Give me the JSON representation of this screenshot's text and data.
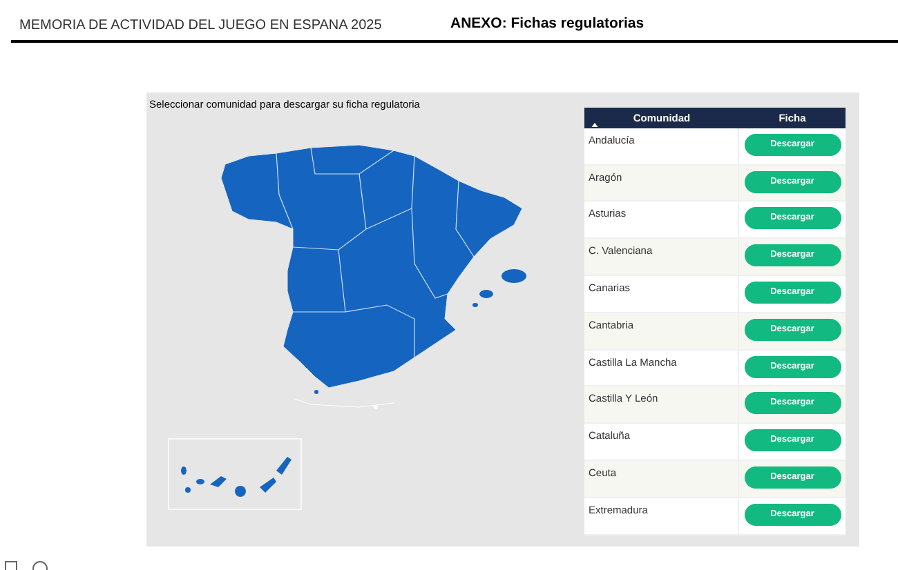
{
  "header": {
    "report_title": "MEMORIA DE ACTIVIDAD DEL JUEGO EN ESPANA 2025",
    "section_title": "ANEXO: Fichas regulatorias"
  },
  "map_panel": {
    "title": "Seleccionar comunidad para descargar su ficha regulatoria"
  },
  "table": {
    "columns": [
      "Comunidad",
      "Ficha"
    ],
    "rows": [
      {
        "comunidad": "Andalucía",
        "ficha": "Descargar"
      },
      {
        "comunidad": "Aragón",
        "ficha": "Descargar"
      },
      {
        "comunidad": "Asturias",
        "ficha": "Descargar"
      },
      {
        "comunidad": "C. Valenciana",
        "ficha": "Descargar"
      },
      {
        "comunidad": "Canarias",
        "ficha": "Descargar"
      },
      {
        "comunidad": "Cantabria",
        "ficha": "Descargar"
      },
      {
        "comunidad": "Castilla La Mancha",
        "ficha": "Descargar"
      },
      {
        "comunidad": "Castilla Y León",
        "ficha": "Descargar"
      },
      {
        "comunidad": "Cataluña",
        "ficha": "Descargar"
      },
      {
        "comunidad": "Ceuta",
        "ficha": "Descargar"
      },
      {
        "comunidad": "Extremadura",
        "ficha": "Descargar"
      }
    ]
  }
}
